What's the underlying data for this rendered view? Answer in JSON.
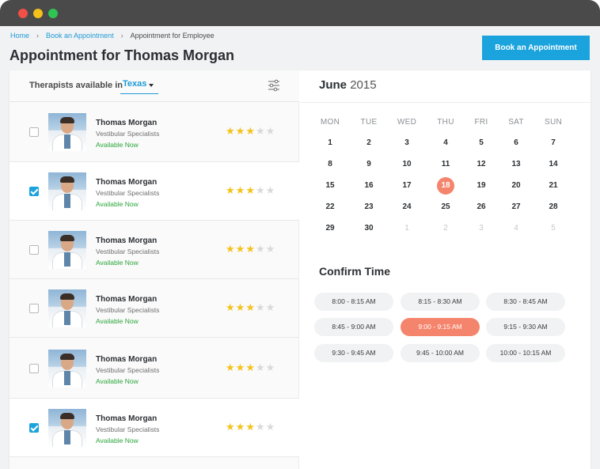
{
  "breadcrumb": {
    "items": [
      "Home",
      "Book an Appointment",
      "Appointment for Employee"
    ]
  },
  "page": {
    "title": "Appointment for Thomas Morgan",
    "book_button": "Book an Appointment"
  },
  "filter": {
    "label": "Therapists available in",
    "state": "Texas"
  },
  "therapists": [
    {
      "name": "Thomas Morgan",
      "specialty": "Vestibular Specialists",
      "status": "Available Now",
      "rating": 3,
      "selected": false
    },
    {
      "name": "Thomas Morgan",
      "specialty": "Vestibular Specialists",
      "status": "Available Now",
      "rating": 3,
      "selected": true
    },
    {
      "name": "Thomas Morgan",
      "specialty": "Vestibular Specialists",
      "status": "Available Now",
      "rating": 3,
      "selected": false
    },
    {
      "name": "Thomas Morgan",
      "specialty": "Vestibular Specialists",
      "status": "Available Now",
      "rating": 3,
      "selected": false
    },
    {
      "name": "Thomas Morgan",
      "specialty": "Vestibular Specialists",
      "status": "Available Now",
      "rating": 3,
      "selected": false
    },
    {
      "name": "Thomas Morgan",
      "specialty": "Vestibular Specialists",
      "status": "Available Now",
      "rating": 3,
      "selected": true
    }
  ],
  "calendar": {
    "month": "June",
    "year": "2015",
    "weekdays": [
      "MON",
      "TUE",
      "WED",
      "THU",
      "FRI",
      "SAT",
      "SUN"
    ],
    "weeks": [
      [
        "1",
        "2",
        "3",
        "4",
        "5",
        "6",
        "7"
      ],
      [
        "8",
        "9",
        "10",
        "11",
        "12",
        "13",
        "14"
      ],
      [
        "15",
        "16",
        "17",
        "18",
        "19",
        "20",
        "21"
      ],
      [
        "22",
        "23",
        "24",
        "25",
        "26",
        "27",
        "28"
      ],
      [
        "29",
        "30",
        "1",
        "2",
        "3",
        "4",
        "5"
      ]
    ],
    "selected_day": "18",
    "muted_from_week": 4,
    "muted_from_col": 2
  },
  "confirm": {
    "title": "Confirm Time",
    "slots": [
      "8:00 - 8:15 AM",
      "8:15 - 8:30 AM",
      "8:30 - 8:45 AM",
      "8:45 - 9:00 AM",
      "9:00 - 9:15 AM",
      "9:15 - 9:30 AM",
      "9:30 - 9:45 AM",
      "9:45 - 10:00 AM",
      "10:00 - 10:15 AM"
    ],
    "selected_slot": "9:00 - 9:15 AM"
  },
  "colors": {
    "accent": "#1aa3dd",
    "highlight": "#f5846c",
    "available": "#2aa53a",
    "star": "#f4c21a"
  }
}
